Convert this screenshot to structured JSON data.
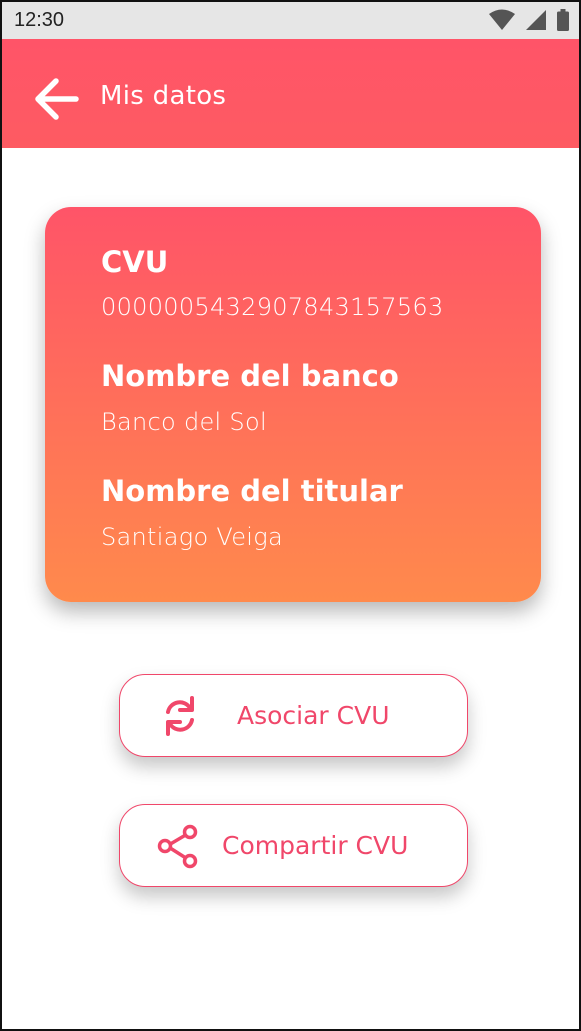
{
  "status_bar": {
    "time": "12:30",
    "icons": [
      "wifi-icon",
      "signal-icon",
      "battery-icon"
    ]
  },
  "header": {
    "back_icon": "arrow-left-icon",
    "title": "Mis datos",
    "colors": {
      "background": "#ff5468",
      "text": "#ffffff"
    }
  },
  "card": {
    "fields": [
      {
        "label": "CVU",
        "value": "0000005432907843157563"
      },
      {
        "label": "Nombre del banco",
        "value": "Banco del Sol"
      },
      {
        "label": "Nombre del titular",
        "value": "Santiago Veiga"
      }
    ],
    "colors": {
      "gradient_start": "#ff5468",
      "gradient_end": "#ff8a4c"
    }
  },
  "actions": [
    {
      "label": "Asociar CVU",
      "icon": "sync-icon"
    },
    {
      "label": "Compartir CVU",
      "icon": "share-icon"
    }
  ],
  "accent_color": "#f0476a"
}
